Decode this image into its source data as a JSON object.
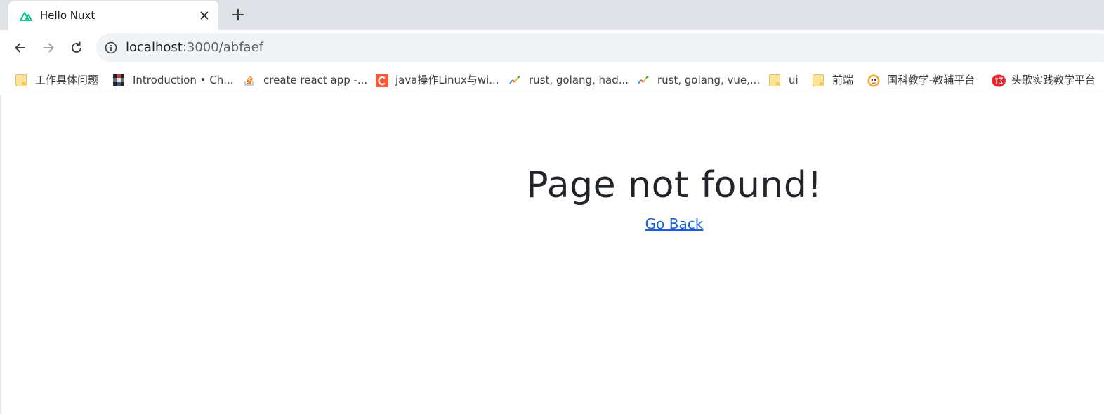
{
  "tab": {
    "title": "Hello Nuxt",
    "favicon": "nuxt-logo-icon",
    "accent": "#00c58e"
  },
  "toolbar": {
    "back_icon": "arrow-left-icon",
    "forward_icon": "arrow-right-icon",
    "reload_icon": "reload-icon",
    "url_host": "localhost",
    "url_rest": ":3000/abfaef"
  },
  "bookmarks": [
    {
      "label": "工作具体问题",
      "icon": "folder-icon"
    },
    {
      "label": "Introduction • Ch...",
      "icon": "site-favicon-icon"
    },
    {
      "label": "create react app -...",
      "icon": "stackoverflow-icon"
    },
    {
      "label": "java操作Linux与wi...",
      "icon": "csdn-icon"
    },
    {
      "label": "rust, golang, had...",
      "icon": "trend-chart-icon"
    },
    {
      "label": "rust, golang, vue,...",
      "icon": "trend-chart-icon"
    },
    {
      "label": "ui",
      "icon": "folder-icon"
    },
    {
      "label": "前端",
      "icon": "folder-icon"
    },
    {
      "label": "国科教学-教辅平台",
      "icon": "school-logo-icon"
    },
    {
      "label": "头歌实践教学平台",
      "icon": "touge-logo-icon"
    }
  ],
  "page": {
    "heading": "Page not found!",
    "back_link": "Go Back"
  },
  "colors": {
    "tab_strip": "#dee1e6",
    "omnibox": "#f1f3f4",
    "link": "#1a5fd6",
    "heading": "#212529"
  }
}
